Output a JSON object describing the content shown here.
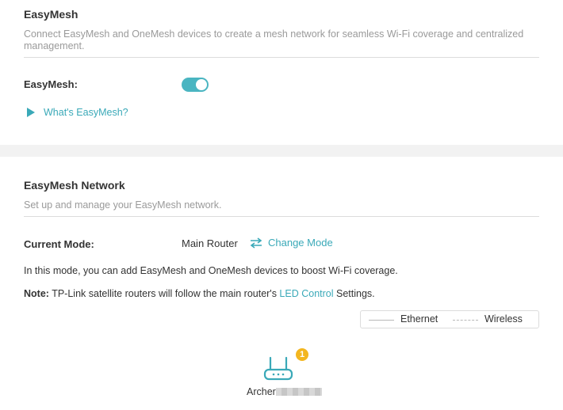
{
  "easymesh": {
    "title": "EasyMesh",
    "description": "Connect EasyMesh and OneMesh devices to create a mesh network for seamless Wi-Fi coverage and centralized management.",
    "toggle_label": "EasyMesh:",
    "toggle_on": true,
    "help_link": "What's EasyMesh?"
  },
  "network": {
    "title": "EasyMesh Network",
    "description": "Set up and manage your EasyMesh network.",
    "mode_label": "Current Mode:",
    "mode_value": "Main Router",
    "change_mode": "Change Mode",
    "info": "In this mode, you can add EasyMesh and OneMesh devices to boost Wi-Fi coverage.",
    "note_label": "Note:",
    "note_before": " TP-Link satellite routers will follow the main router's ",
    "note_link": "LED Control",
    "note_after": " Settings."
  },
  "legend": {
    "ethernet": "Ethernet",
    "wireless": "Wireless"
  },
  "topology": {
    "device_name": "Archer",
    "badge_count": "1",
    "icon": "router-icon"
  },
  "colors": {
    "accent": "#4ab5c1",
    "link": "#3aa9b8",
    "badge": "#f3b61f"
  }
}
